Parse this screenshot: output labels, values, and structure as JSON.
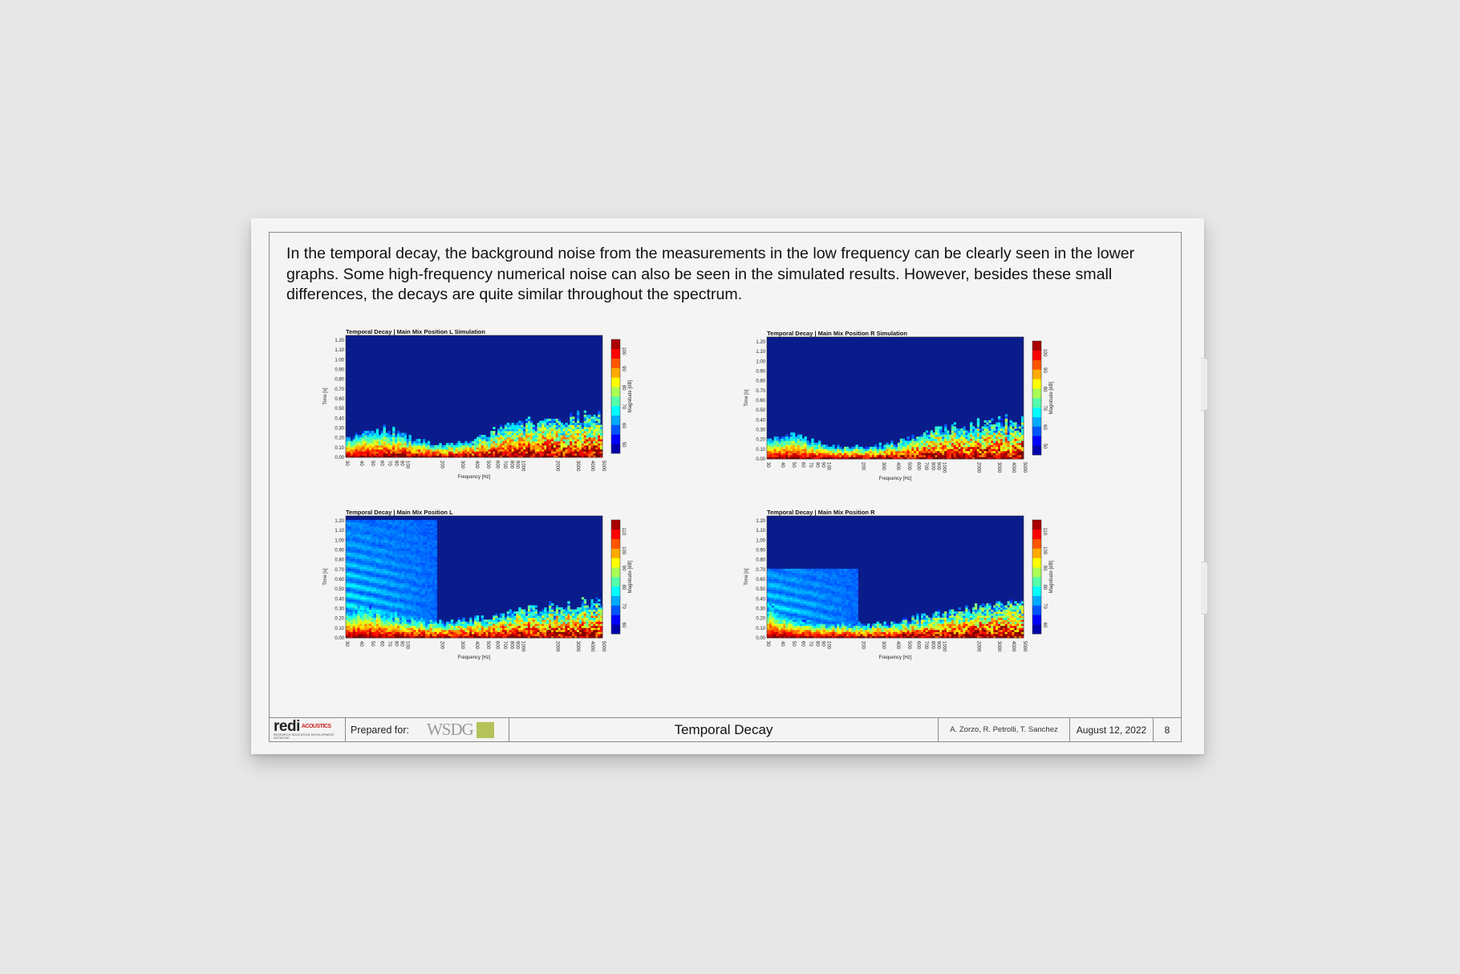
{
  "intro": "In the temporal decay, the background noise from the measurements in the low frequency can be clearly seen in the lower graphs. Some high-frequency numerical noise can also be seen in the simulated results. However, besides these small differences, the decays are quite similar throughout the spectrum.",
  "chart_data": [
    {
      "type": "heatmap",
      "title": "Temporal Decay | Main Mix Position L Simulation",
      "xlabel": "Frequency [Hz]",
      "ylabel": "Time [s]",
      "colorbar_label": "Magnitude [dB]",
      "x_scale": "log",
      "x_ticks": [
        "30",
        "40",
        "50",
        "60",
        "70",
        "80",
        "90",
        "100",
        "200",
        "300",
        "400",
        "500",
        "600",
        "700",
        "800",
        "900",
        "1000",
        "2000",
        "3000",
        "4000",
        "5000"
      ],
      "y_ticks": [
        "0.00",
        "0.10",
        "0.20",
        "0.30",
        "0.40",
        "0.50",
        "0.60",
        "0.70",
        "0.80",
        "0.90",
        "1.00",
        "1.10",
        "1.20"
      ],
      "colorbar_ticks": [
        "50",
        "60",
        "70",
        "80",
        "90",
        "100"
      ],
      "floor_s": [
        0.18,
        0.25,
        0.28,
        0.22,
        0.15,
        0.12,
        0.16,
        0.22,
        0.3,
        0.34,
        0.36,
        0.38,
        0.4,
        0.42
      ]
    },
    {
      "type": "heatmap",
      "title": "Temporal Decay | Main Mix Position R Simulation",
      "xlabel": "Frequency [Hz]",
      "ylabel": "Time [s]",
      "colorbar_label": "Magnitude [dB]",
      "x_scale": "log",
      "x_ticks": [
        "30",
        "40",
        "50",
        "60",
        "70",
        "80",
        "90",
        "100",
        "200",
        "300",
        "400",
        "500",
        "600",
        "700",
        "800",
        "900",
        "1000",
        "2000",
        "3000",
        "4000",
        "5000"
      ],
      "y_ticks": [
        "0.00",
        "0.10",
        "0.20",
        "0.30",
        "0.40",
        "0.50",
        "0.60",
        "0.70",
        "0.80",
        "0.90",
        "1.00",
        "1.10",
        "1.20"
      ],
      "colorbar_ticks": [
        "50",
        "60",
        "70",
        "80",
        "90",
        "100"
      ],
      "floor_s": [
        0.2,
        0.26,
        0.2,
        0.15,
        0.12,
        0.12,
        0.14,
        0.2,
        0.28,
        0.32,
        0.34,
        0.36,
        0.38,
        0.4
      ]
    },
    {
      "type": "heatmap",
      "title": "Temporal Decay | Main Mix Position L",
      "xlabel": "Frequency [Hz]",
      "ylabel": "Time [s]",
      "colorbar_label": "Magnitude [dB]",
      "x_scale": "log",
      "x_ticks": [
        "30",
        "40",
        "50",
        "60",
        "70",
        "80",
        "90",
        "100",
        "200",
        "300",
        "400",
        "500",
        "600",
        "700",
        "800",
        "900",
        "1000",
        "2000",
        "3000",
        "4000",
        "5000"
      ],
      "y_ticks": [
        "0.00",
        "0.10",
        "0.20",
        "0.30",
        "0.40",
        "0.50",
        "0.60",
        "0.70",
        "0.80",
        "0.90",
        "1.00",
        "1.10",
        "1.20"
      ],
      "colorbar_ticks": [
        "60",
        "70",
        "80",
        "90",
        "100",
        "110"
      ],
      "floor_s": [
        0.28,
        0.3,
        0.25,
        0.2,
        0.17,
        0.16,
        0.18,
        0.2,
        0.24,
        0.28,
        0.3,
        0.32,
        0.34,
        0.36
      ],
      "noise_extent_s": 1.2
    },
    {
      "type": "heatmap",
      "title": "Temporal Decay | Main Mix Position R",
      "xlabel": "Frequency [Hz]",
      "ylabel": "Time [s]",
      "colorbar_label": "Magnitude [dB]",
      "x_scale": "log",
      "x_ticks": [
        "30",
        "40",
        "50",
        "60",
        "70",
        "80",
        "90",
        "100",
        "200",
        "300",
        "400",
        "500",
        "600",
        "700",
        "800",
        "900",
        "1000",
        "2000",
        "3000",
        "4000",
        "5000"
      ],
      "y_ticks": [
        "0.00",
        "0.10",
        "0.20",
        "0.30",
        "0.40",
        "0.50",
        "0.60",
        "0.70",
        "0.80",
        "0.90",
        "1.00",
        "1.10",
        "1.20"
      ],
      "colorbar_ticks": [
        "60",
        "70",
        "80",
        "90",
        "100",
        "110"
      ],
      "floor_s": [
        0.3,
        0.22,
        0.16,
        0.14,
        0.14,
        0.14,
        0.14,
        0.18,
        0.22,
        0.26,
        0.3,
        0.32,
        0.34,
        0.36
      ],
      "noise_extent_s": 0.7
    }
  ],
  "footer": {
    "logo_text": "redi",
    "logo_sub": "ACOUSTICS",
    "logo_tag": "RESEARCH EDUCATION DEVELOPMENT INITIATIVE",
    "prepared_for": "Prepared for:",
    "client": "WSDG",
    "title": "Temporal Decay",
    "authors": "A. Zorzo, R. Petrolli, T. Sanchez",
    "date": "August 12, 2022",
    "page": "8"
  },
  "colors": {
    "paper": "#f4f4f4",
    "background": "#e7e7e7",
    "client_accent": "#b5c25a",
    "logo_accent": "#cc1f1f"
  }
}
